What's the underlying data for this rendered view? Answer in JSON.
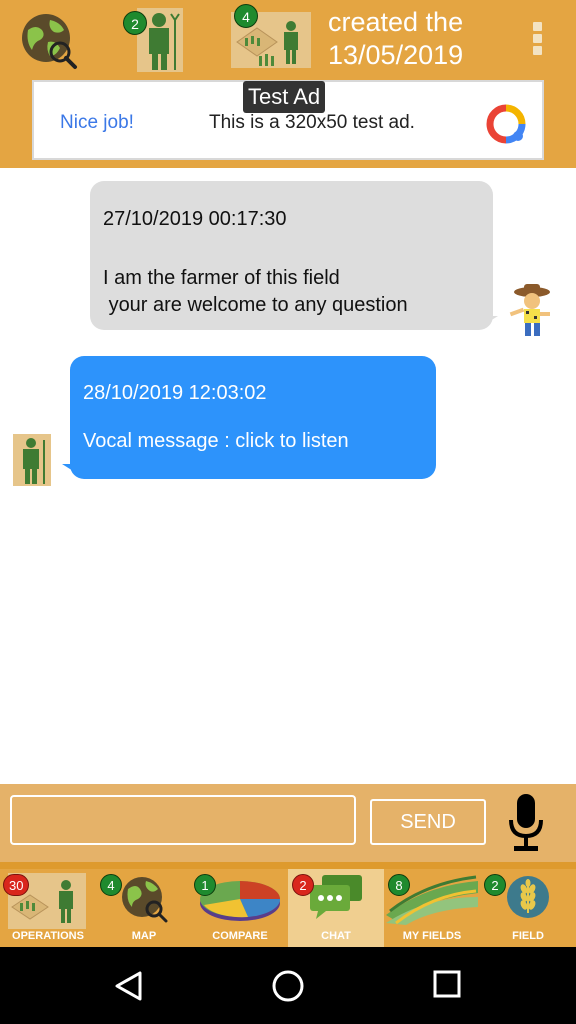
{
  "header": {
    "title": "created the\n13/05/2019",
    "badges": {
      "farmer": "2",
      "fields": "4"
    }
  },
  "ad": {
    "label": "Test Ad",
    "nice_text": "Nice job!",
    "body_text": "This is a 320x50 test ad."
  },
  "messages": [
    {
      "time": "27/10/2019 00:17:30",
      "text": "I am the farmer of this field\n your are welcome to any question",
      "side": "incoming"
    },
    {
      "time": "28/10/2019 12:03:02",
      "text": "Vocal message : click to listen",
      "side": "outgoing"
    }
  ],
  "composer": {
    "input_value": "",
    "send_label": "SEND"
  },
  "tabs": [
    {
      "label": "OPERATIONS",
      "badge": "30",
      "badge_color": "red"
    },
    {
      "label": "MAP",
      "badge": "4",
      "badge_color": "green"
    },
    {
      "label": "COMPARE",
      "badge": "1",
      "badge_color": "green"
    },
    {
      "label": "CHAT",
      "badge": "2",
      "badge_color": "red",
      "active": true
    },
    {
      "label": "MY FIELDS",
      "badge": "8",
      "badge_color": "green"
    },
    {
      "label": "FIELD",
      "badge": "2",
      "badge_color": "green"
    }
  ],
  "colors": {
    "header_bg": "#e4a542",
    "incoming_bubble": "#dddddd",
    "outgoing_bubble": "#2d93fb",
    "active_tab": "#f0cf90"
  }
}
